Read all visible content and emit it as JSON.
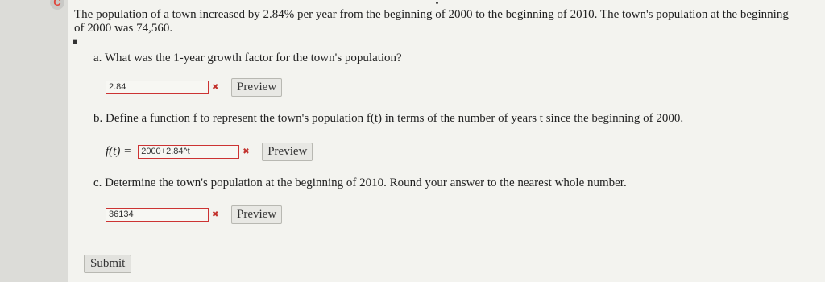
{
  "problem": {
    "text": "The population of a town increased by 2.84% per year from the beginning of 2000 to the beginning of 2010. The town's population at the beginning of 2000 was 74,560."
  },
  "questions": {
    "a": {
      "prompt": "a. What was the 1-year growth factor for the town's population?",
      "answer_value": "2.84",
      "status": "incorrect",
      "preview_label": "Preview"
    },
    "b": {
      "prompt": "b. Define a function f to represent the town's population f(t) in terms of the number of years t since the beginning of 2000.",
      "function_label": "f(t) =",
      "answer_value": "2000+2.84^t",
      "status": "incorrect",
      "preview_label": "Preview"
    },
    "c": {
      "prompt": "c. Determine the town's population at the beginning of 2010. Round your answer to the nearest whole number.",
      "answer_value": "36134",
      "status": "incorrect",
      "preview_label": "Preview"
    }
  },
  "submit_label": "Submit",
  "icons": {
    "incorrect": "x-mark-icon",
    "logo": "app-logo-icon"
  },
  "colors": {
    "error": "#cc3333",
    "background": "#f3f3ef"
  }
}
